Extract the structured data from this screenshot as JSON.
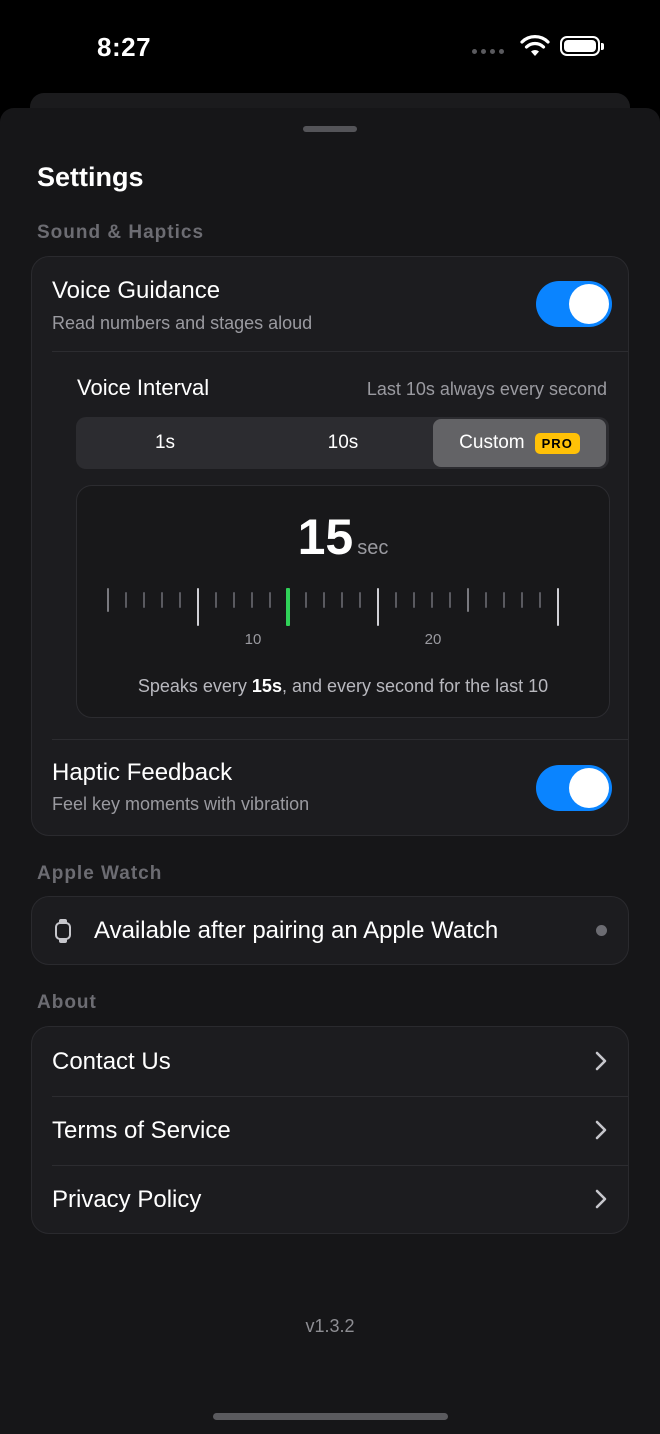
{
  "status_bar": {
    "time": "8:27"
  },
  "sheet": {
    "title": "Settings"
  },
  "sound_haptics": {
    "section_label": "Sound & Haptics",
    "voice_guidance": {
      "title": "Voice Guidance",
      "subtitle": "Read numbers and stages aloud",
      "enabled": true
    },
    "voice_interval": {
      "title": "Voice Interval",
      "note": "Last 10s always every second",
      "options": [
        "1s",
        "10s",
        "Custom"
      ],
      "selected": "Custom",
      "pro_badge": "PRO",
      "value": "15",
      "unit": "sec",
      "ruler_labels": [
        "10",
        "20"
      ],
      "caption_before": "Speaks every ",
      "caption_value": "15s",
      "caption_after": ", and every second for the last 10"
    },
    "haptic_feedback": {
      "title": "Haptic Feedback",
      "subtitle": "Feel key moments with vibration",
      "enabled": true
    }
  },
  "apple_watch": {
    "section_label": "Apple Watch",
    "message": "Available after pairing an Apple Watch"
  },
  "about": {
    "section_label": "About",
    "links": [
      "Contact Us",
      "Terms of Service",
      "Privacy Policy"
    ]
  },
  "version": "v1.3.2",
  "colors": {
    "accent": "#0a84ff",
    "pro": "#ffc107",
    "indicator": "#30d158",
    "background": "#161618"
  }
}
